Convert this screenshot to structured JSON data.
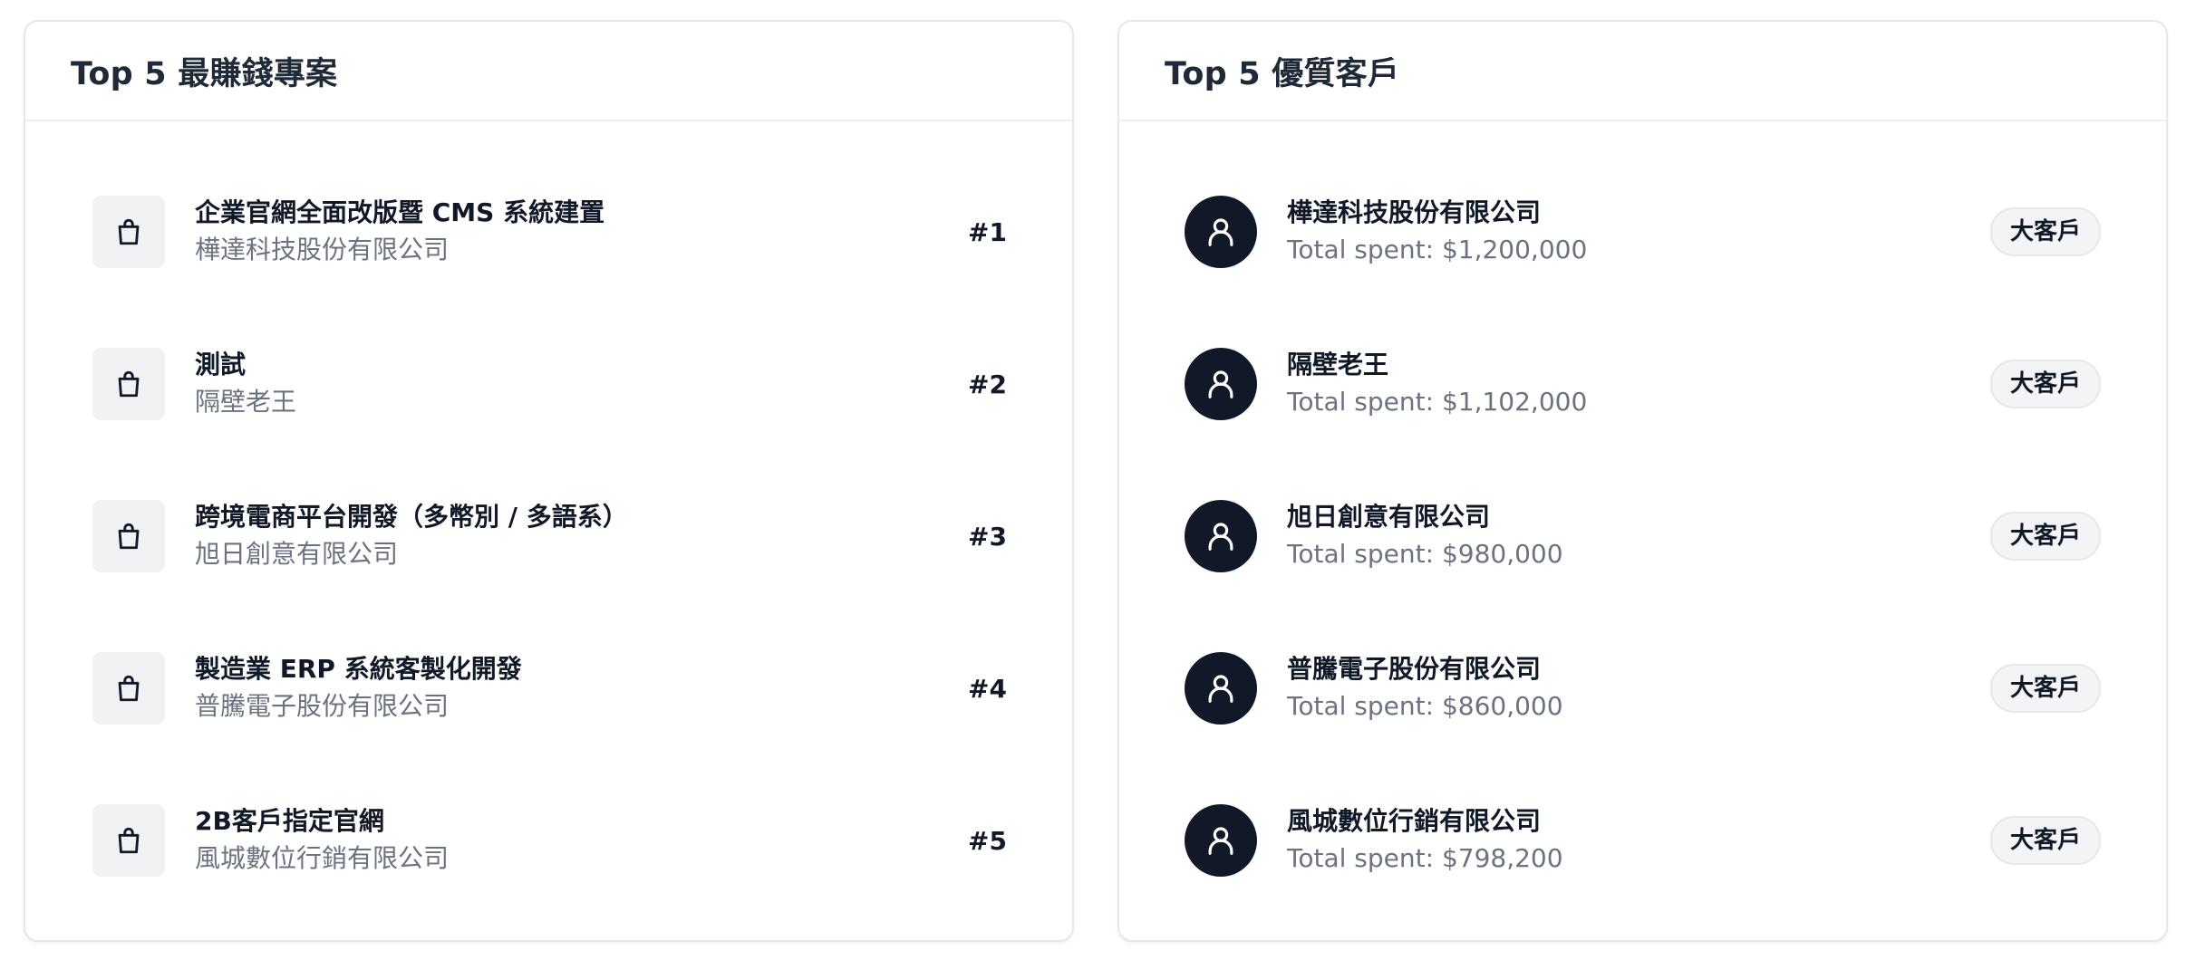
{
  "projects_card": {
    "title": "Top 5 最賺錢專案",
    "items": [
      {
        "name": "企業官網全面改版暨 CMS 系統建置",
        "client": "樺達科技股份有限公司",
        "rank": "#1",
        "icon": "shopping-bag-icon"
      },
      {
        "name": "測試",
        "client": "隔壁老王",
        "rank": "#2",
        "icon": "shopping-bag-icon"
      },
      {
        "name": "跨境電商平台開發（多幣別 / 多語系）",
        "client": "旭日創意有限公司",
        "rank": "#3",
        "icon": "shopping-bag-icon"
      },
      {
        "name": "製造業 ERP 系統客製化開發",
        "client": "普騰電子股份有限公司",
        "rank": "#4",
        "icon": "shopping-bag-icon"
      },
      {
        "name": "2B客戶指定官網",
        "client": "風城數位行銷有限公司",
        "rank": "#5",
        "icon": "shopping-bag-icon"
      }
    ]
  },
  "customers_card": {
    "title": "Top 5 優質客戶",
    "items": [
      {
        "name": "樺達科技股份有限公司",
        "spent": "Total spent: $1,200,000",
        "badge": "大客戶",
        "icon": "user-icon"
      },
      {
        "name": "隔壁老王",
        "spent": "Total spent: $1,102,000",
        "badge": "大客戶",
        "icon": "user-icon"
      },
      {
        "name": "旭日創意有限公司",
        "spent": "Total spent: $980,000",
        "badge": "大客戶",
        "icon": "user-icon"
      },
      {
        "name": "普騰電子股份有限公司",
        "spent": "Total spent: $860,000",
        "badge": "大客戶",
        "icon": "user-icon"
      },
      {
        "name": "風城數位行銷有限公司",
        "spent": "Total spent: $798,200",
        "badge": "大客戶",
        "icon": "user-icon"
      }
    ]
  },
  "colors": {
    "avatar_bg": "#111827",
    "icon_box_bg": "#f1f2f4",
    "secondary_text": "#6b7280",
    "badge_bg": "#f3f4f6"
  }
}
